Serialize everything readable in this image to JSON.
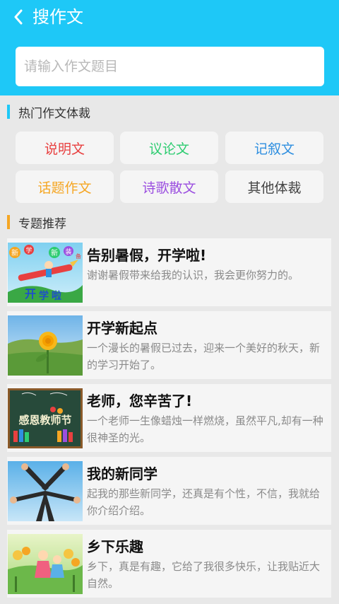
{
  "header": {
    "title": "搜作文"
  },
  "search": {
    "placeholder": "请输入作文题目"
  },
  "genres_section": {
    "title": "热门作文体裁"
  },
  "genres": [
    {
      "label": "说明文",
      "color": "#e84040"
    },
    {
      "label": "议论文",
      "color": "#2ecc71"
    },
    {
      "label": "记叙文",
      "color": "#2f8fe0"
    },
    {
      "label": "话题作文",
      "color": "#f5a623"
    },
    {
      "label": "诗歌散文",
      "color": "#9b4fe0"
    },
    {
      "label": "其他体裁",
      "color": "#444444"
    }
  ],
  "topics_section": {
    "title": "专题推荐"
  },
  "topics": [
    {
      "title": "告别暑假，开学啦!",
      "desc": "谢谢暑假带来给我的认识，我会更你努力的。"
    },
    {
      "title": "开学新起点",
      "desc": "一个漫长的暑假已过去，迎来一个美好的秋天，新的学习开始了。"
    },
    {
      "title": "老师，您辛苦了!",
      "desc": "一个老师一生像蜡烛一样燃烧，虽然平凡,却有一种很神圣的光。"
    },
    {
      "title": "我的新同学",
      "desc": "起我的那些新同学，还真是有个性，不信，我就给你介绍介绍。"
    },
    {
      "title": "乡下乐趣",
      "desc": "乡下，真是有趣，它给了我很多快乐，让我贴近大自然。"
    }
  ],
  "thumb_texts": {
    "t1_a": "新",
    "t1_b": "学",
    "t1_c": "新",
    "t1_d": "装",
    "t1_e": "备",
    "t1_f": "开",
    "t1_g": "学",
    "t1_h": "啦",
    "t3_a": "感恩教师节"
  },
  "colors": {
    "header": "#1ec8f7",
    "section_bar_1": "#1ec8f7",
    "section_bar_2": "#f5a623"
  }
}
